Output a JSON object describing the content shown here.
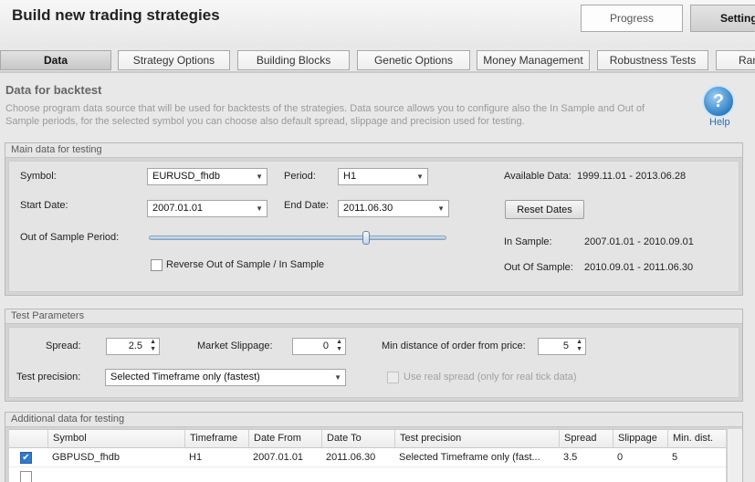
{
  "app": {
    "title": "Build new trading strategies"
  },
  "top_buttons": {
    "progress": "Progress",
    "settings": "Settings"
  },
  "tabs": [
    "Data",
    "Strategy Options",
    "Building Blocks",
    "Genetic Options",
    "Money Management",
    "Robustness Tests",
    "Ranki"
  ],
  "section": {
    "title": "Data for backtest",
    "description": "Choose program data source that will be used for backtests of the strategies. Data source allows you to configure also the In Sample and Out of Sample periods, for the selected symbol you can choose also default spread, slippage and precision used for testing.",
    "help_label": "Help",
    "help_glyph": "?"
  },
  "main_data": {
    "panel_title": "Main data for testing",
    "symbol_label": "Symbol:",
    "symbol_value": "EURUSD_fhdb",
    "period_label": "Period:",
    "period_value": "H1",
    "available_label": "Available Data:",
    "available_value": "1999.11.01 - 2013.06.28",
    "start_label": "Start Date:",
    "start_value": "2007.01.01",
    "end_label": "End Date:",
    "end_value": "2011.06.30",
    "reset_button": "Reset Dates",
    "oos_label": "Out of Sample Period:",
    "oos_slider_fraction": 0.73,
    "in_sample_label": "In Sample:",
    "in_sample_value": "2007.01.01 - 2010.09.01",
    "reverse_label": "Reverse Out of Sample / In Sample",
    "reverse_checked": false,
    "out_sample_label": "Out Of Sample:",
    "out_sample_value": "2010.09.01 - 2011.06.30"
  },
  "test_params": {
    "panel_title": "Test Parameters",
    "spread_label": "Spread:",
    "spread_value": "2.5",
    "slippage_label": "Market Slippage:",
    "slippage_value": "0",
    "min_dist_label": "Min distance of order from price:",
    "min_dist_value": "5",
    "precision_label": "Test precision:",
    "precision_value": "Selected Timeframe only (fastest)",
    "real_spread_label": "Use real spread (only for real tick data)",
    "real_spread_checked": false
  },
  "additional": {
    "panel_title": "Additional data for testing",
    "columns": [
      "Symbol",
      "Timeframe",
      "Date From",
      "Date To",
      "Test precision",
      "Spread",
      "Slippage",
      "Min. dist."
    ],
    "rows": [
      {
        "checked": true,
        "symbol": "GBPUSD_fhdb",
        "timeframe": "H1",
        "date_from": "2007.01.01",
        "date_to": "2011.06.30",
        "precision": "Selected Timeframe only (fast...",
        "spread": "3.5",
        "slippage": "0",
        "min_dist": "5"
      },
      {
        "checked": false,
        "symbol": "",
        "timeframe": "",
        "date_from": "",
        "date_to": "",
        "precision": "",
        "spread": "",
        "slippage": "",
        "min_dist": ""
      }
    ]
  },
  "colors": {
    "accent": "#2e7bcf",
    "help": "#2f7fc4",
    "panel": "#d4d4d4"
  },
  "icons": {
    "dropdown": "chevron-down-icon",
    "spin": "spinner-arrows-icon",
    "help": "question-icon"
  }
}
